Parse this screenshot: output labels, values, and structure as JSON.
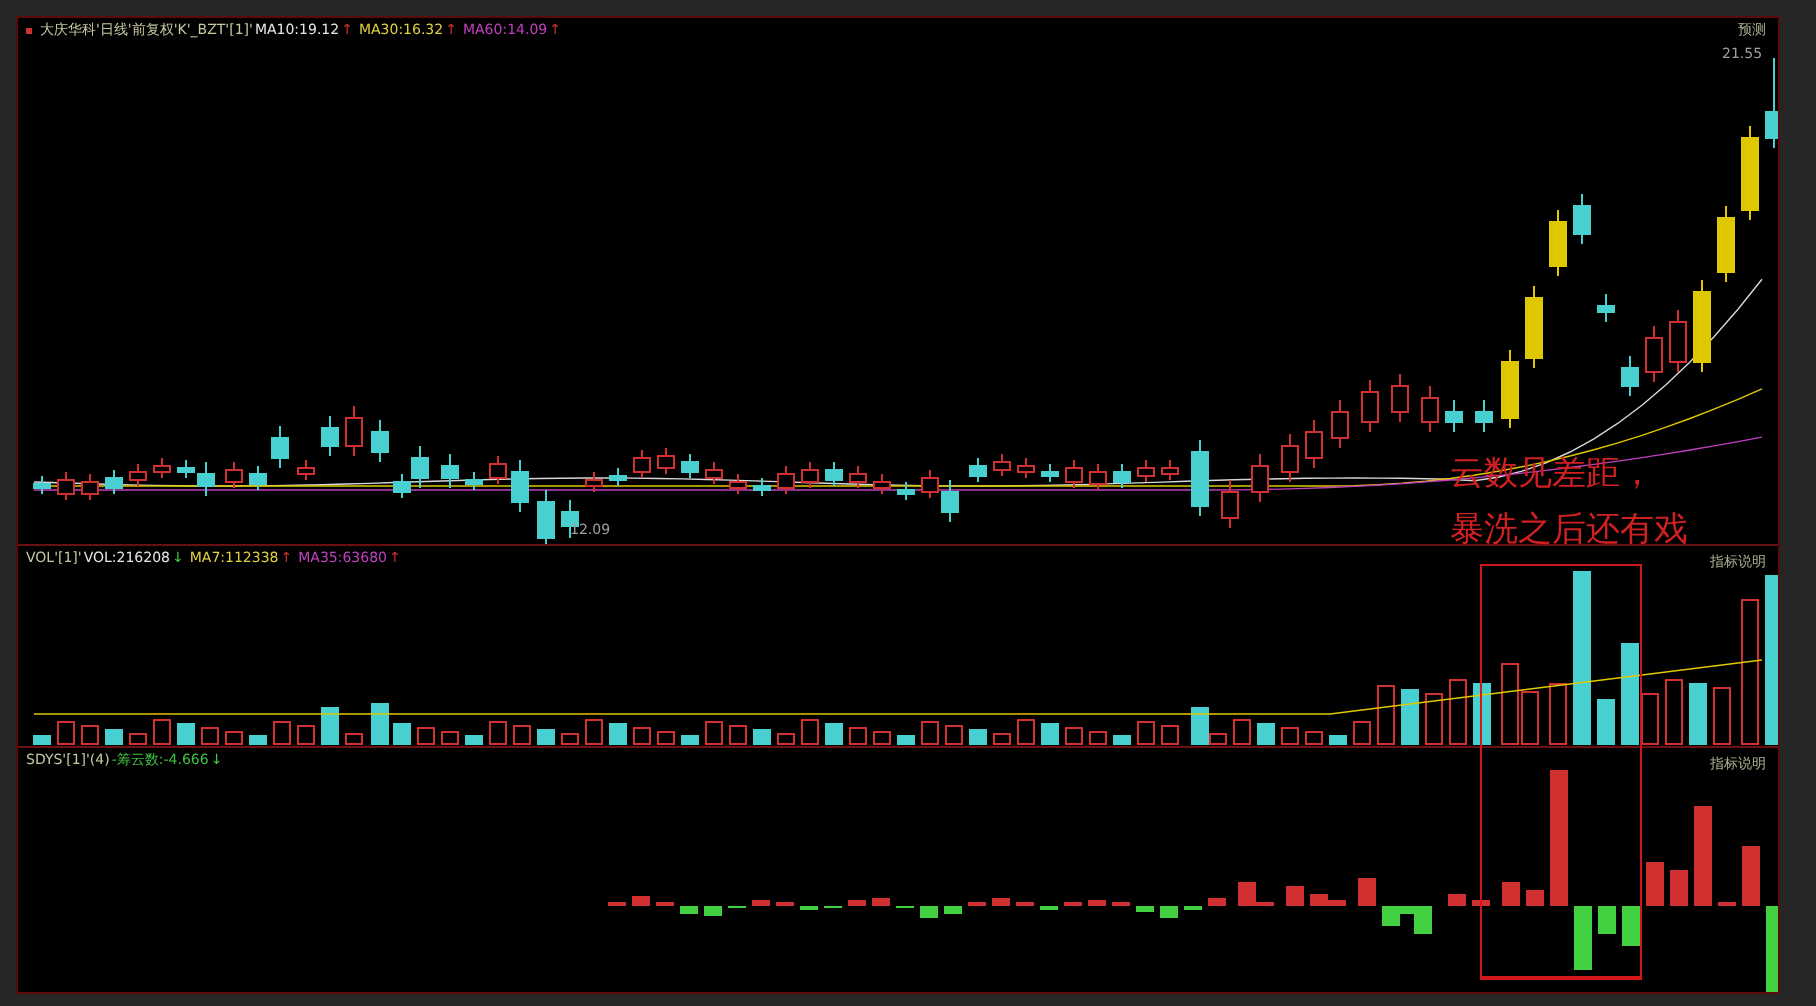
{
  "price_panel": {
    "title": "大庆华科'日线'前复权'K'_BZT'[1]'",
    "indicators": [
      {
        "label": "MA10:19.12",
        "arrow": "↑",
        "color": "#e8e8e8"
      },
      {
        "label": "MA30:16.32",
        "arrow": "↑",
        "color": "#e0d040"
      },
      {
        "label": "MA60:14.09",
        "arrow": "↑",
        "color": "#c040c0"
      }
    ],
    "forecast_label": "预测",
    "high_label": "21.55",
    "low_label": "12.09",
    "annotation": [
      "云数见差距，",
      "暴洗之后还有戏"
    ]
  },
  "volume_panel": {
    "title": "VOL'[1]'",
    "indicators": [
      {
        "label": "VOL:216208",
        "arrow": "↓",
        "color": "#e8e8e8"
      },
      {
        "label": "MA7:112338",
        "arrow": "↑",
        "color": "#e0d040"
      },
      {
        "label": "MA35:63680",
        "arrow": "↑",
        "color": "#c040c0"
      }
    ],
    "note": "指标说明"
  },
  "indicator_panel": {
    "title": "SDYS'[1]'(4)",
    "value": "-筹云数:-4.666",
    "arrow": "↓",
    "note": "指标说明"
  }
}
